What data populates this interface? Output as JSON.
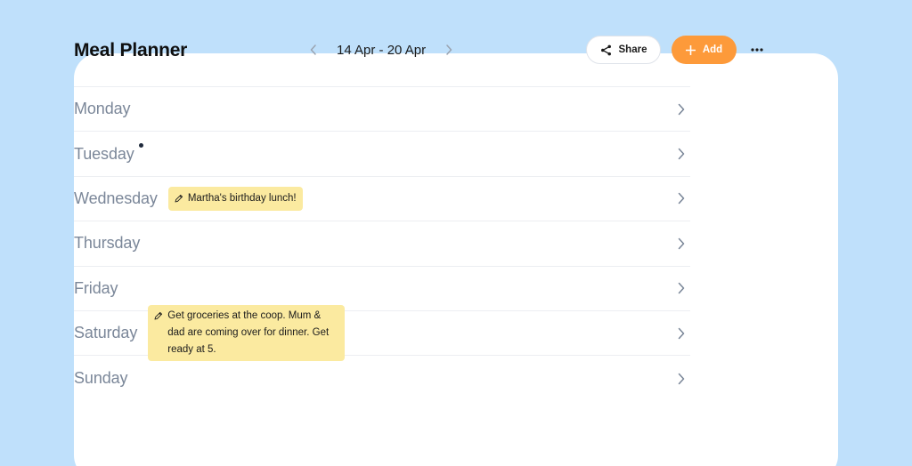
{
  "header": {
    "title": "Meal Planner",
    "week_range": "14 Apr - 20 Apr",
    "share_label": "Share",
    "add_label": "Add"
  },
  "days": [
    {
      "name": "Monday",
      "note": null,
      "dot": false
    },
    {
      "name": "Tuesday",
      "note": null,
      "dot": true
    },
    {
      "name": "Wednesday",
      "note": "Martha's birthday lunch!",
      "dot": false
    },
    {
      "name": "Thursday",
      "note": null,
      "dot": false
    },
    {
      "name": "Friday",
      "note": null,
      "dot": false
    },
    {
      "name": "Saturday",
      "note": "Get groceries at the coop. Mum & dad are coming over for dinner. Get ready at 5.",
      "dot": false
    },
    {
      "name": "Sunday",
      "note": null,
      "dot": false
    }
  ],
  "colors": {
    "background": "#bfe0fb",
    "accent": "#fd9a3a",
    "note_bg": "#fbeaa0",
    "day_text": "#7b8799"
  }
}
